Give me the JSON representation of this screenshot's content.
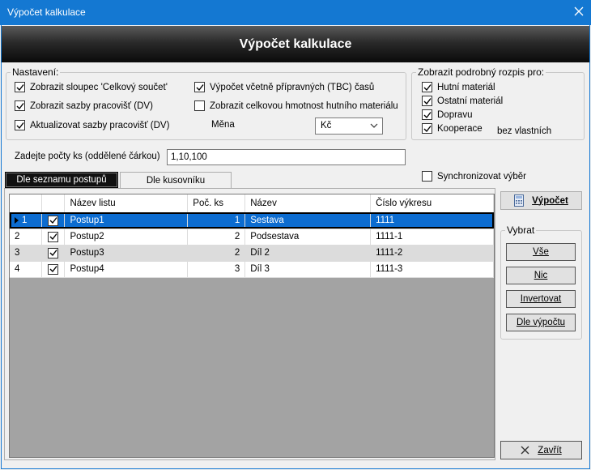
{
  "window": {
    "title": "Výpočet kalkulace",
    "close_glyph": "✕"
  },
  "header": {
    "title": "Výpočet kalkulace"
  },
  "settings": {
    "legend": "Nastavení:",
    "items": [
      {
        "label": "Zobrazit sloupec 'Celkový součet'",
        "checked": true
      },
      {
        "label": "Zobrazit sazby pracovišť (DV)",
        "checked": true
      },
      {
        "label": "Aktualizovat sazby pracovišť (DV)",
        "checked": true
      },
      {
        "label": "Výpočet včetně přípravných (TBC) časů",
        "checked": true
      },
      {
        "label": "Zobrazit celkovou hmotnost hutního materiálu",
        "checked": false
      }
    ],
    "currency_label": "Měna",
    "currency_value": "Kč"
  },
  "detail": {
    "legend": "Zobrazit podrobný rozpis pro:",
    "items": [
      {
        "label": "Hutní materiál",
        "checked": true
      },
      {
        "label": "Ostatní materiál",
        "checked": true
      },
      {
        "label": "Dopravu",
        "checked": true
      },
      {
        "label": "Kooperace",
        "checked": true
      }
    ],
    "note": "bez vlastních"
  },
  "quantity": {
    "label": "Zadejte počty ks (oddělené čárkou)",
    "value": "1,10,100"
  },
  "tabs": [
    {
      "label": "Dle seznamu postupů",
      "active": true
    },
    {
      "label": "Dle kusovníku",
      "active": false
    }
  ],
  "sync": {
    "label": "Synchronizovat výběr",
    "checked": false
  },
  "grid": {
    "columns": [
      "",
      "",
      "Název listu",
      "Poč. ks",
      "Název",
      "Číslo výkresu"
    ],
    "rows": [
      {
        "idx": "1",
        "checked": true,
        "sheet": "Postup1",
        "qty": "1",
        "name": "Sestava",
        "drawing": "1111",
        "selected": true
      },
      {
        "idx": "2",
        "checked": true,
        "sheet": "Postup2",
        "qty": "2",
        "name": "Podsestava",
        "drawing": "1111-1",
        "selected": false
      },
      {
        "idx": "3",
        "checked": true,
        "sheet": "Postup3",
        "qty": "2",
        "name": "Díl 2",
        "drawing": "1111-2",
        "selected": false
      },
      {
        "idx": "4",
        "checked": true,
        "sheet": "Postup4",
        "qty": "3",
        "name": "Díl 3",
        "drawing": "1111-3",
        "selected": false
      }
    ]
  },
  "actions": {
    "calc_label": "Výpočet",
    "select_legend": "Vybrat",
    "select_all": "Vše",
    "select_none": "Nic",
    "invert": "Invertovat",
    "by_calc": "Dle výpočtu",
    "close_label": "Zavřít"
  },
  "colors": {
    "titlebar": "#1478d2",
    "selection": "#0c6cd0",
    "alt_row": "#dcdcdc",
    "grid_bg": "#a3a3a3"
  }
}
